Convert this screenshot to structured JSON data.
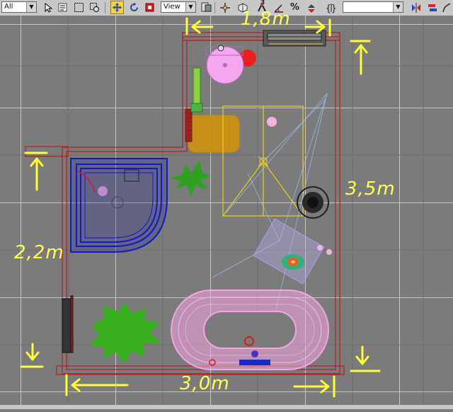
{
  "toolbar": {
    "selection_filter": "All",
    "reference_coord": "View",
    "named_selection": "",
    "snap_label": "3",
    "percent_snap_label": "%",
    "icons": [
      "select-object",
      "select-by-name",
      "rect-selection-region",
      "window-crossing",
      "select-and-move",
      "select-and-rotate",
      "select-and-scale",
      "use-pivot-center",
      "select-and-manipulate",
      "snaps-toggle",
      "angle-snap",
      "percent-snap",
      "spinner-snap",
      "edit-named-selections",
      "mirror",
      "align",
      "curve-editor"
    ]
  },
  "viewport": {
    "background_color": "#7b7b7b",
    "grid_color": "#bcbcbc",
    "annotation_color": "#ffff33",
    "dimensions": {
      "top_width": "1,8m",
      "right_height": "3,5m",
      "left_height": "2,2m",
      "bottom_width": "3,0m"
    },
    "objects": [
      "sink",
      "towel-rail",
      "cabinet",
      "corner-shower",
      "bathroom-rug",
      "plant-small",
      "plant-large",
      "radiator",
      "oval-bathtub",
      "toilet",
      "ceiling-light",
      "stool"
    ]
  }
}
